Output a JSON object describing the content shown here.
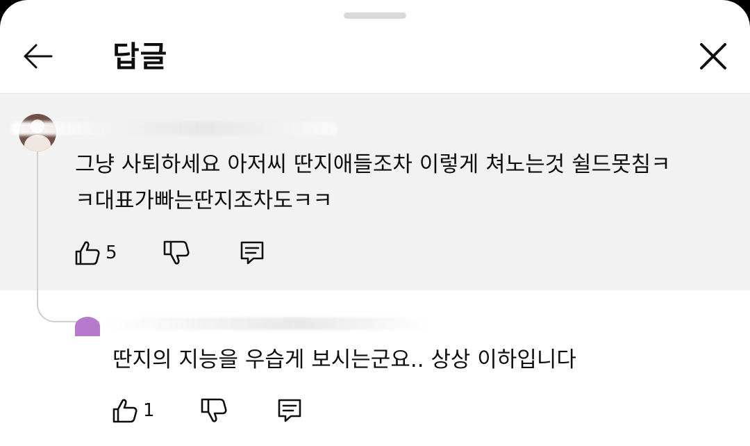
{
  "header": {
    "title": "답글"
  },
  "comments": [
    {
      "text_line1": "그냥 사퇴하세요 아저씨 딴지애들조차 이렇게 쳐노는것 쉴드못침ㅋ",
      "text_line2": "ㅋ대표가빠는딴지조차도ㅋㅋ",
      "likes": "5"
    },
    {
      "text_line1": "딴지의 지능을 우습게 보시는군요.. 상상 이하입니다",
      "likes": "1"
    }
  ]
}
